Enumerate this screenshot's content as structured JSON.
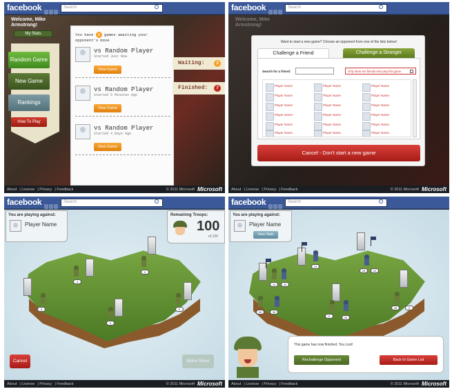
{
  "fb": {
    "logo": "facebook",
    "search_placeholder": "Search"
  },
  "footer": {
    "links": [
      "About",
      "License",
      "Privacy",
      "Feedback"
    ],
    "copyright": "© 2011 Microsoft",
    "brand": "Microsoft"
  },
  "lobby": {
    "welcome": "Welcome, Mike Armstrong!",
    "my_stats": "My Stats",
    "nav": [
      "Random Game",
      "New Game",
      "Rankings",
      "How To Play"
    ],
    "summary_pre": "You have",
    "summary_count": "3",
    "summary_post": "games awaiting your opponent's move",
    "games": [
      {
        "title": "vs Random Player",
        "sub": "Started Just Now",
        "button": "View Game"
      },
      {
        "title": "vs Random Player",
        "sub": "Started 5 Minutes Ago",
        "button": "View Game"
      },
      {
        "title": "vs Random Player",
        "sub": "Started 4 Days Ago",
        "button": "View Game"
      }
    ],
    "waiting": {
      "label": "Waiting:",
      "count": "3",
      "color": "#f7a022"
    },
    "finished": {
      "label": "Finished:",
      "count": "7",
      "color": "#c0271d"
    }
  },
  "dialog": {
    "prompt": "Want to start a new game? Choose an opponent from one of the lists below!",
    "tab_friend": "Challenge a Friend",
    "tab_stranger": "Challenge a Stranger",
    "search_label": "Search for a friend:",
    "only_show": "Only show me friends who play this game",
    "player_names": [
      "Player Name",
      "Player Name",
      "Player Name",
      "Player Name",
      "Player Name",
      "Player Name",
      "Player Name",
      "Player Name",
      "Player Name",
      "Player Name",
      "Player Name",
      "Player Name",
      "Player Name",
      "Player Name",
      "Player Name",
      "Player Name",
      "Player Name",
      "Player Name"
    ],
    "cancel": "Cancel - Don't start a new game"
  },
  "map": {
    "playing_against": "You are playing against:",
    "opponent": "Player Name",
    "view_stats": "View Stats",
    "remaining_label": "Remaining Troops:",
    "remaining": "100",
    "of_total": "of 100",
    "cancel": "Cancel",
    "make_move": "Make Move",
    "counts_a": [
      "0",
      "0",
      "0",
      "0",
      "0",
      "0"
    ]
  },
  "result": {
    "counts": [
      "24",
      "33",
      "26",
      "24",
      "33",
      "24",
      "0",
      "34",
      "26",
      "0",
      "24"
    ],
    "message": "This game has now finished. You Lost!",
    "rechallenge": "Rechallenge Opponent",
    "back": "Back to Game List"
  }
}
